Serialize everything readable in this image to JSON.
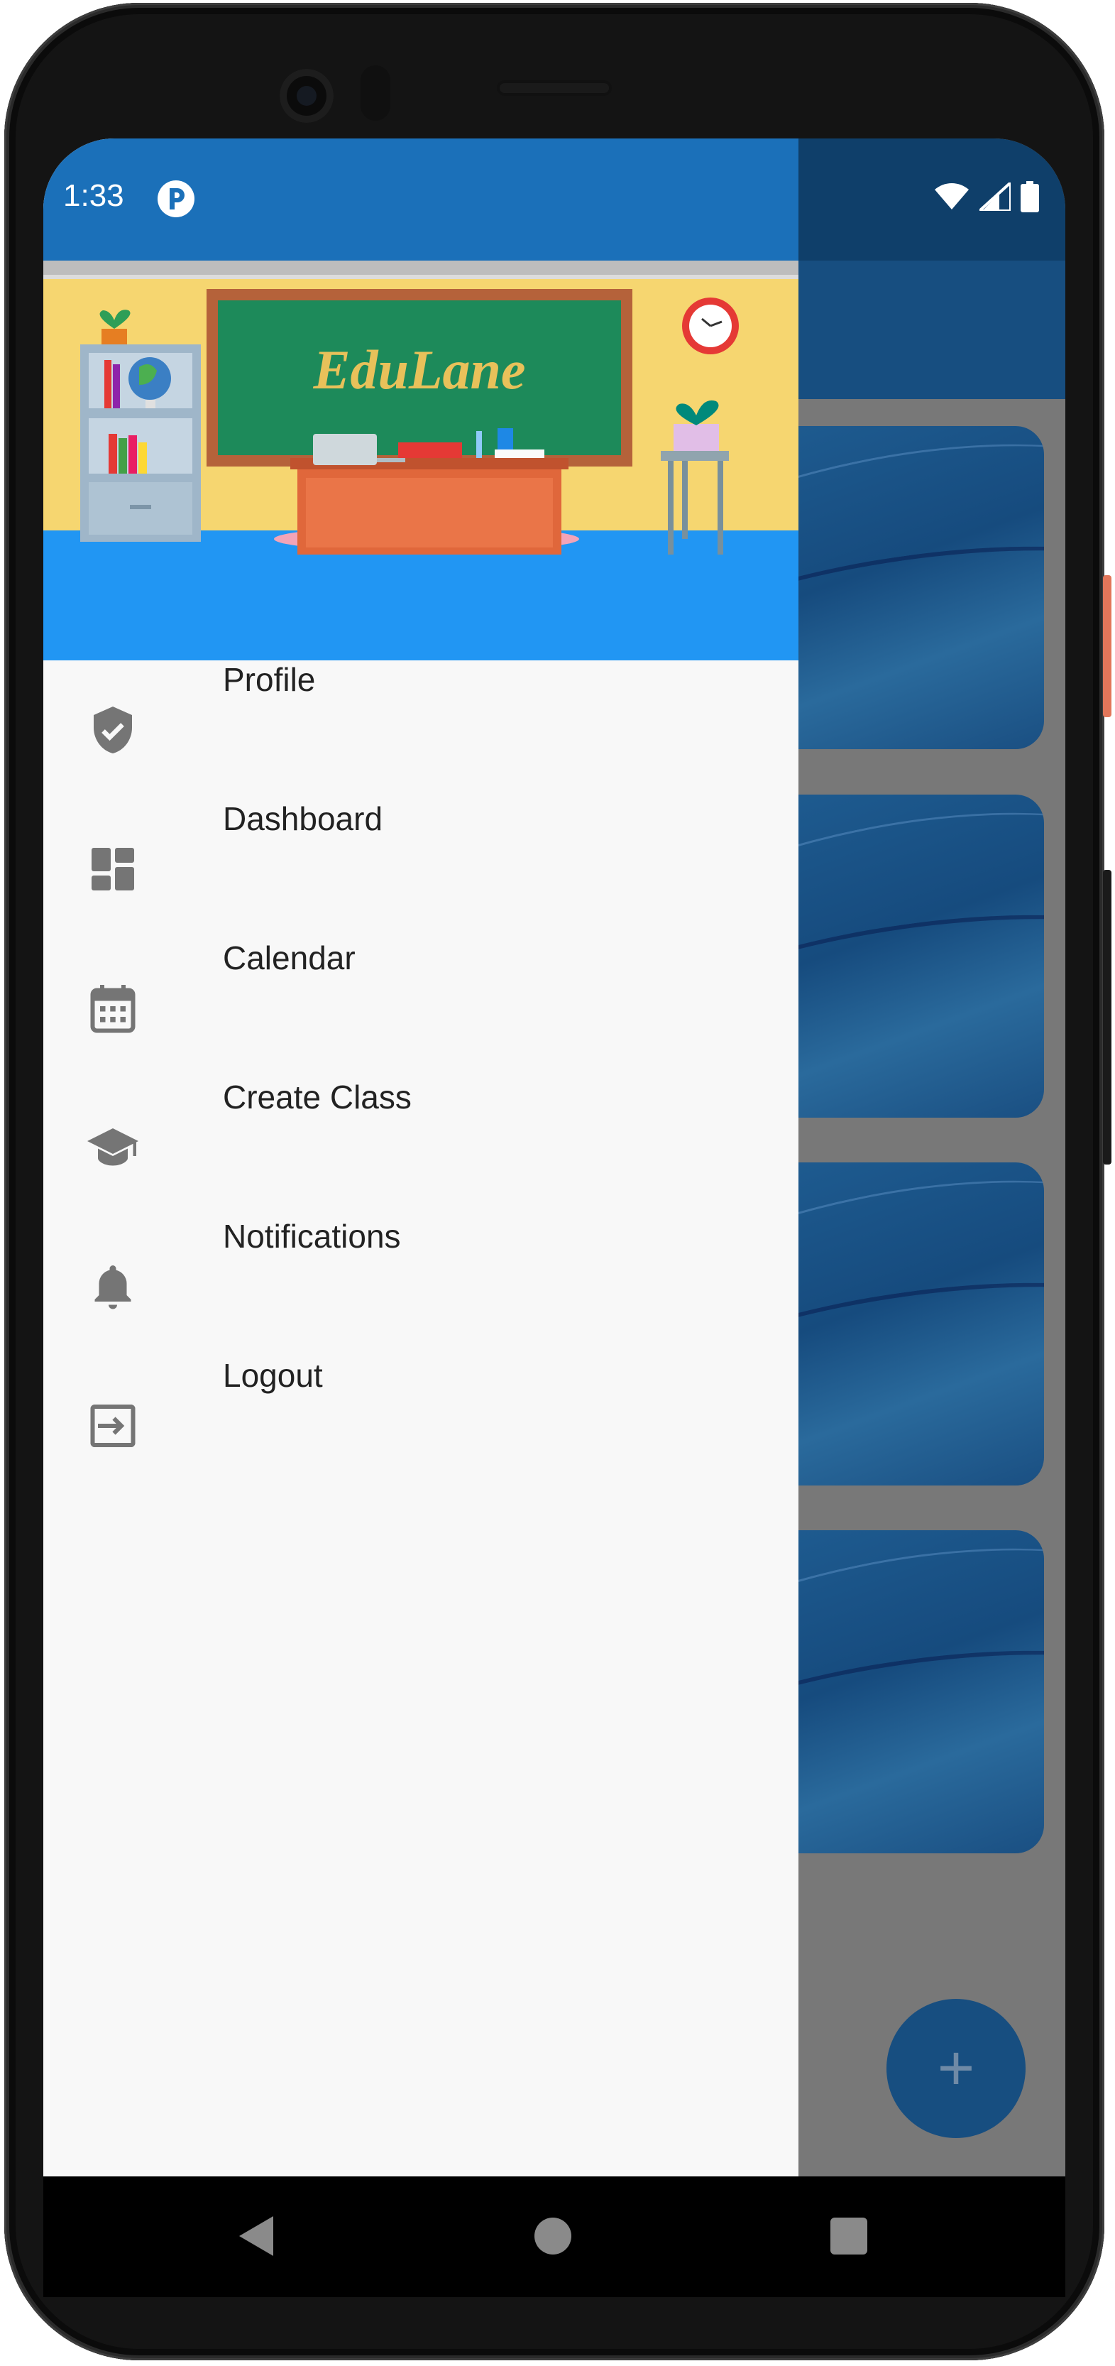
{
  "status_bar": {
    "time": "1:33"
  },
  "header": {
    "brand": "EduLane"
  },
  "menu": {
    "items": [
      {
        "label": "Profile",
        "icon": "shield-check-icon"
      },
      {
        "label": "Dashboard",
        "icon": "dashboard-icon"
      },
      {
        "label": "Calendar",
        "icon": "calendar-icon"
      },
      {
        "label": "Create Class",
        "icon": "graduation-cap-icon"
      },
      {
        "label": "Notifications",
        "icon": "bell-icon"
      },
      {
        "label": "Logout",
        "icon": "exit-icon"
      }
    ]
  },
  "background_app": {
    "card_count": 4,
    "fab_label": "+"
  },
  "colors": {
    "drawer_header": "#2196f3",
    "drawer_status": "#1b70b9",
    "app_bar": "#174e80",
    "menu_icon": "#757575"
  }
}
